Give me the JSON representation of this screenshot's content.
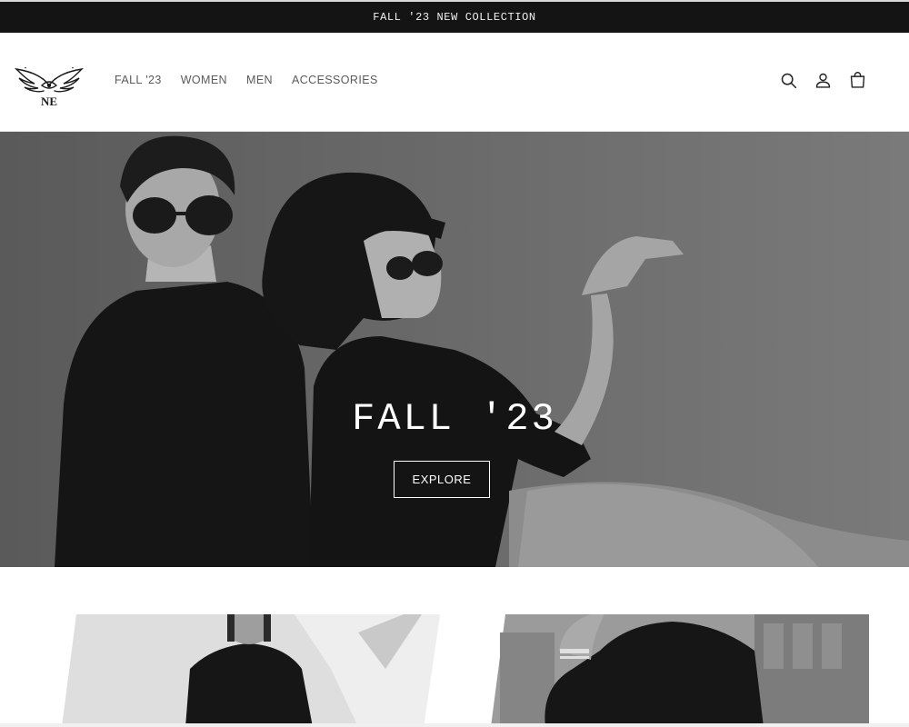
{
  "announcement": {
    "text": "FALL '23 NEW COLLECTION"
  },
  "header": {
    "logo": {
      "text": "NE",
      "icon": "winged-eye-logo"
    },
    "nav": [
      {
        "label": "FALL '23"
      },
      {
        "label": "WOMEN"
      },
      {
        "label": "MEN"
      },
      {
        "label": "ACCESSORIES"
      }
    ],
    "icons": [
      "search-icon",
      "account-icon",
      "cart-icon"
    ]
  },
  "hero": {
    "title": "FALL '23",
    "button_label": "EXPLORE",
    "image": "black-and-white-fashion-couple-sunglasses"
  },
  "collection_cards": [
    {
      "image": "woman-black-long-sleeve-top"
    },
    {
      "image": "man-black-hoodie"
    }
  ],
  "colors": {
    "announcement_bg": "#141414",
    "announcement_text": "#f2f2f2",
    "nav_text": "#5a5a5a",
    "hero_text": "#ffffff"
  }
}
